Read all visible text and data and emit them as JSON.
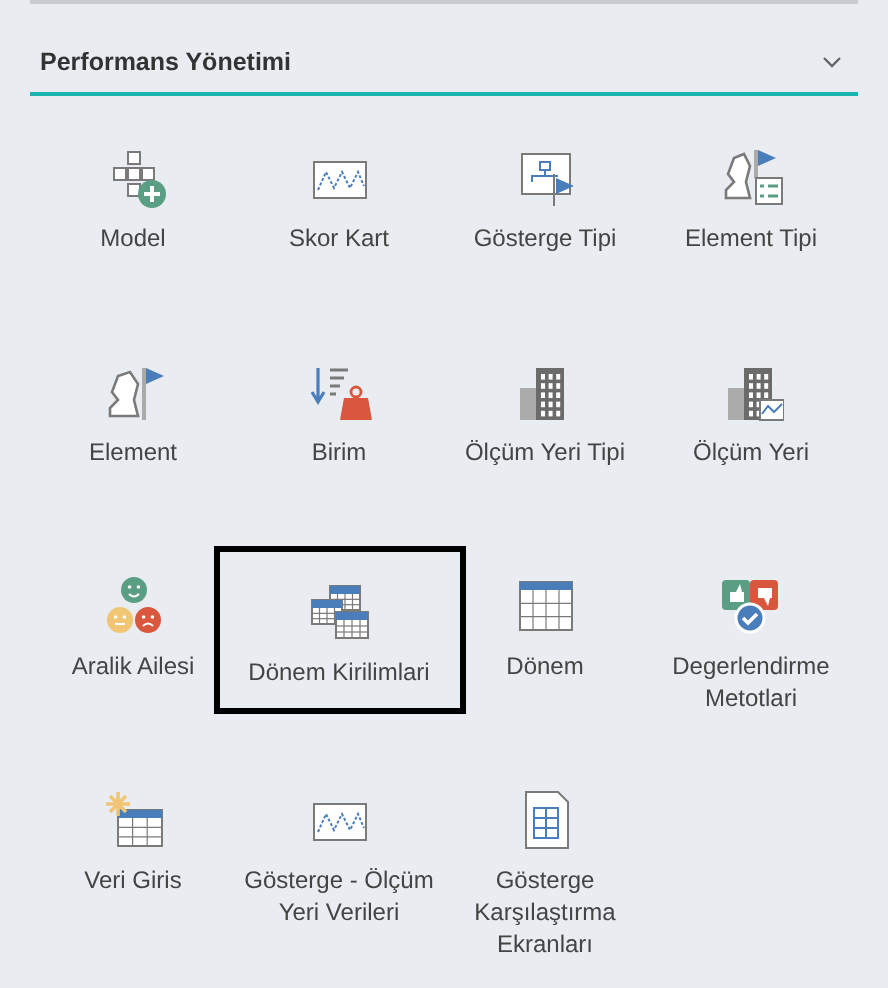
{
  "section": {
    "title": "Performans Yönetimi",
    "expanded": true
  },
  "tiles": [
    {
      "label": "Model",
      "selected": false
    },
    {
      "label": "Skor Kart",
      "selected": false
    },
    {
      "label": "Gösterge Tipi",
      "selected": false
    },
    {
      "label": "Element Tipi",
      "selected": false
    },
    {
      "label": "Element",
      "selected": false
    },
    {
      "label": "Birim",
      "selected": false
    },
    {
      "label": "Ölçüm Yeri Tipi",
      "selected": false
    },
    {
      "label": "Ölçüm Yeri",
      "selected": false
    },
    {
      "label": "Aralik Ailesi",
      "selected": false
    },
    {
      "label": "Dönem Kirilimlari",
      "selected": true
    },
    {
      "label": "Dönem",
      "selected": false
    },
    {
      "label": "Degerlendirme\nMetotlari",
      "selected": false
    },
    {
      "label": "Veri Giris",
      "selected": false
    },
    {
      "label": "Gösterge - Ölçüm\nYeri Verileri",
      "selected": false
    },
    {
      "label": "Gösterge\nKarşılaştırma\nEkranları",
      "selected": false
    }
  ]
}
